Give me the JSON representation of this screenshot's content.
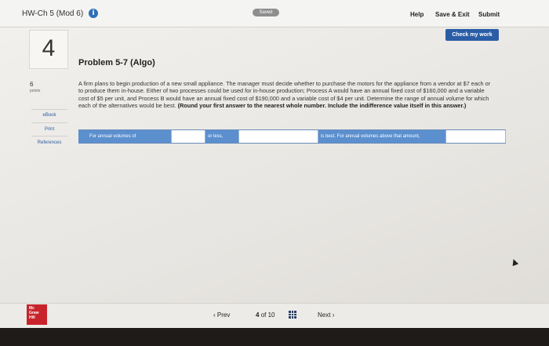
{
  "header": {
    "hw_title": "HW-Ch 5 (Mod 6)",
    "info_glyph": "i",
    "saved_label": "Saved",
    "help_label": "Help",
    "save_exit_label": "Save & Exit",
    "submit_label": "Submit",
    "check_work_label": "Check my work"
  },
  "sidebar": {
    "question_number": "4",
    "points_value": "6",
    "points_label": "points",
    "links": [
      "eBook",
      "Print",
      "References"
    ]
  },
  "problem": {
    "title": "Problem 5-7 (Algo)",
    "text": "A firm plans to begin production of a new small appliance. The manager must decide whether to purchase the motors for the appliance from a vendor at $7 each or to produce them in-house. Either of two processes could be used for in-house production; Process A would have an annual fixed cost of $160,000 and a variable cost of $5 per unit, and Process B would have an annual fixed cost of $190,000 and a variable cost of $4 per unit. Determine the range of annual volume for which each of the alternatives would be best.",
    "instruction": "(Round your first answer to the nearest whole number. Include the indifference value itself in this answer.)"
  },
  "answer_row": {
    "label1": "For annual volumes of",
    "input1_value": "",
    "input1_alternative": "",
    "label2": "or less,",
    "input2_value": "",
    "label3": "is best. For annual volumes above that amount,"
  },
  "footer": {
    "logo_text": "Mc Graw Hill",
    "prev_label": "Prev",
    "page_current": "4",
    "page_of": "of",
    "page_total": "10",
    "next_label": "Next"
  },
  "colors": {
    "accent_blue": "#2a5da6",
    "row_blue": "#5b8fce",
    "logo_red": "#c8232b"
  },
  "icons": [
    "info-icon",
    "chevron-left-icon",
    "chevron-right-icon",
    "grid-icon"
  ]
}
